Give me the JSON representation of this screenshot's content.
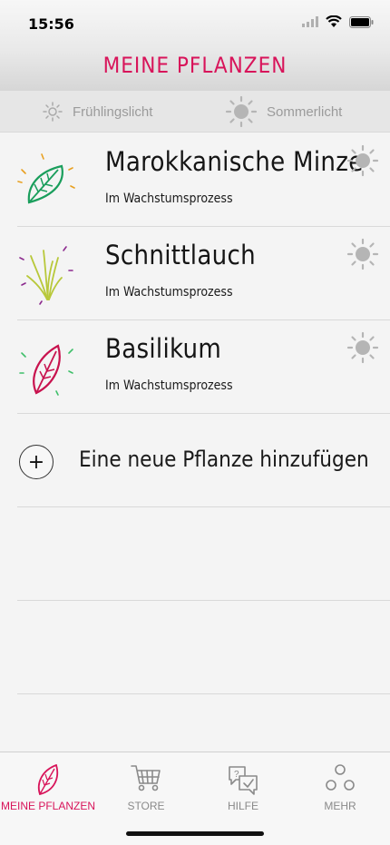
{
  "status_bar": {
    "time": "15:56"
  },
  "header": {
    "title": "MEINE PFLANZEN"
  },
  "light_options": [
    {
      "label": "Frühlingslicht",
      "icon": "spring-light-icon"
    },
    {
      "label": "Sommerlicht",
      "icon": "summer-light-icon"
    }
  ],
  "plants": [
    {
      "name": "Marokkanische Minze",
      "status": "Im Wachstumsprozess",
      "icon": "mint-leaf-icon",
      "color": "#1a9e5c"
    },
    {
      "name": "Schnittlauch",
      "status": "Im Wachstumsprozess",
      "icon": "chives-icon",
      "color": "#b8c83a"
    },
    {
      "name": "Basilikum",
      "status": "Im Wachstumsprozess",
      "icon": "basil-leaf-icon",
      "color": "#c8124e"
    }
  ],
  "add_plant": {
    "label": "Eine neue Pflanze hinzufügen",
    "icon": "plus-icon"
  },
  "tabs": [
    {
      "label": "MEINE PFLANZEN",
      "icon": "leaf-icon",
      "active": true
    },
    {
      "label": "STORE",
      "icon": "cart-icon",
      "active": false
    },
    {
      "label": "HILFE",
      "icon": "help-chat-icon",
      "active": false
    },
    {
      "label": "MEHR",
      "icon": "more-circles-icon",
      "active": false
    }
  ],
  "colors": {
    "accent": "#d8145a",
    "inactive": "#8a8a8a",
    "sun": "#b5b5b5"
  }
}
